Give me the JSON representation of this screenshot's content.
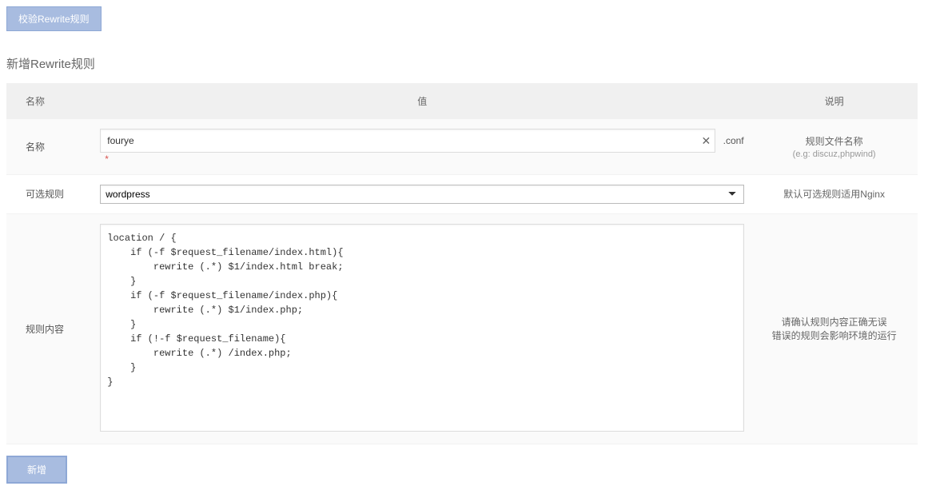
{
  "buttons": {
    "validate": "校验Rewrite规则",
    "add": "新增"
  },
  "section_title": "新增Rewrite规则",
  "table": {
    "headers": {
      "name": "名称",
      "value": "值",
      "desc": "说明"
    },
    "rows": {
      "name": {
        "label": "名称",
        "input_value": "fourye",
        "suffix": ".conf",
        "desc_title": "规则文件名称",
        "desc_eg": "(e.g: discuz,phpwind)"
      },
      "optional": {
        "label": "可选规则",
        "select_value": "wordpress",
        "desc": "默认可选规则适用Nginx"
      },
      "content": {
        "label": "规则内容",
        "textarea_value": "location / {\n    if (-f $request_filename/index.html){\n        rewrite (.*) $1/index.html break;\n    }\n    if (-f $request_filename/index.php){\n        rewrite (.*) $1/index.php;\n    }\n    if (!-f $request_filename){\n        rewrite (.*) /index.php;\n    }\n}",
        "desc_line1": "请确认规则内容正确无误",
        "desc_line2": "错误的规则会影响环境的运行"
      }
    }
  }
}
